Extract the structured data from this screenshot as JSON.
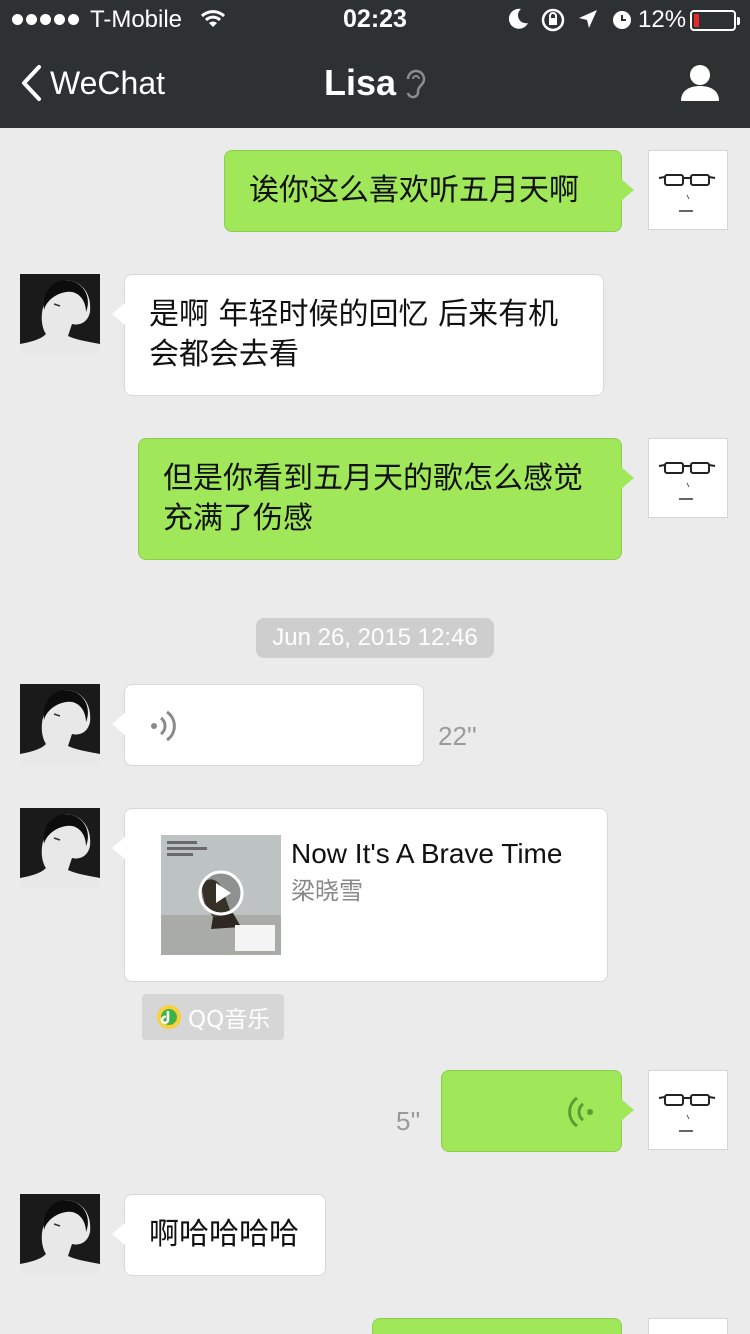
{
  "status_bar": {
    "carrier": "T-Mobile",
    "time": "02:23",
    "battery_percent": "12%",
    "battery_level": 0.12,
    "battery_color": "#e82a2a",
    "icons": [
      "signal-dots-icon",
      "wifi-icon",
      "moon-icon",
      "rotation-lock-icon",
      "location-icon",
      "alarm-icon",
      "battery-icon"
    ]
  },
  "nav": {
    "back_label": "WeChat",
    "title": "Lisa",
    "title_icon": "earpiece-icon",
    "right_icon": "profile-icon"
  },
  "colors": {
    "nav_background": "#2e3132",
    "chat_background": "#ebebeb",
    "sent_bubble": "#a0e75a",
    "received_bubble": "#ffffff"
  },
  "messages": {
    "m1": {
      "from": "me",
      "text": "诶你这么喜欢听五月天啊"
    },
    "m2": {
      "from": "Lisa",
      "text": "是啊 年轻时候的回忆 后来有机会都会去看"
    },
    "m3": {
      "from": "me",
      "text": "但是你看到五月天的歌怎么感觉充满了伤感"
    },
    "timestamp": "Jun 26, 2015 12:46",
    "m4": {
      "from": "Lisa",
      "type": "voice",
      "duration": "22''"
    },
    "m5": {
      "from": "Lisa",
      "type": "music",
      "song": "Now It's A Brave Time",
      "artist": "梁晓雪",
      "source": "QQ音乐"
    },
    "m6": {
      "from": "me",
      "type": "voice",
      "duration": "5''"
    },
    "m7": {
      "from": "Lisa",
      "text": "啊哈哈哈哈"
    }
  }
}
